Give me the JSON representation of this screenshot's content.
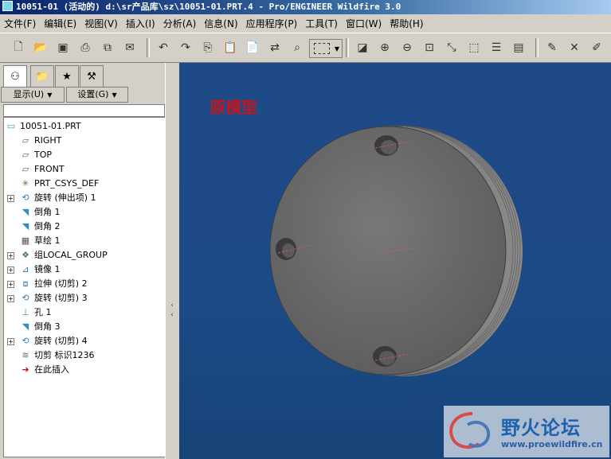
{
  "window": {
    "title": "10051-01 (活动的) d:\\sr产品库\\sz\\10051-01.PRT.4 - Pro/ENGINEER Wildfire 3.0"
  },
  "menu": [
    "文件(F)",
    "编辑(E)",
    "视图(V)",
    "插入(I)",
    "分析(A)",
    "信息(N)",
    "应用程序(P)",
    "工具(T)",
    "窗口(W)",
    "帮助(H)"
  ],
  "toolbar": {
    "icons": [
      "new-icon",
      "open-icon",
      "save-icon",
      "print-icon",
      "copy-window-icon",
      "email-icon",
      "undo-icon",
      "redo-icon",
      "copy-icon",
      "paste-icon",
      "paste-special-icon",
      "regenerate-icon",
      "find-icon",
      "select-box-icon",
      "repaint-icon",
      "zoom-in-icon",
      "zoom-out-icon",
      "refit-icon",
      "orient-icon",
      "saved-views-icon",
      "layers-icon",
      "view-manager-icon",
      "edit-definition-icon",
      "close-icon",
      "sketch-icon"
    ]
  },
  "panel": {
    "tabs": [
      "model-tree-tab",
      "folder-browser-tab",
      "favorites-tab",
      "connections-tab"
    ],
    "show_label": "显示(U)",
    "settings_label": "设置(G)"
  },
  "tree": [
    {
      "label": "10051-01.PRT",
      "icon": "part-icon",
      "indent": 0,
      "expandable": false
    },
    {
      "label": "RIGHT",
      "icon": "datum-plane-icon",
      "indent": 1,
      "expandable": false
    },
    {
      "label": "TOP",
      "icon": "datum-plane-icon",
      "indent": 1,
      "expandable": false
    },
    {
      "label": "FRONT",
      "icon": "datum-plane-icon",
      "indent": 1,
      "expandable": false
    },
    {
      "label": "PRT_CSYS_DEF",
      "icon": "csys-icon",
      "indent": 1,
      "expandable": false
    },
    {
      "label": "旋转 (伸出项) 1",
      "icon": "revolve-icon",
      "indent": 1,
      "expandable": true
    },
    {
      "label": "倒角 1",
      "icon": "chamfer-icon",
      "indent": 1,
      "expandable": false
    },
    {
      "label": "倒角 2",
      "icon": "chamfer-icon",
      "indent": 1,
      "expandable": false
    },
    {
      "label": "草绘 1",
      "icon": "sketch-icon",
      "indent": 1,
      "expandable": false
    },
    {
      "label": "组LOCAL_GROUP",
      "icon": "group-icon",
      "indent": 1,
      "expandable": true
    },
    {
      "label": "镜像 1",
      "icon": "mirror-icon",
      "indent": 1,
      "expandable": true
    },
    {
      "label": "拉伸 (切剪) 2",
      "icon": "extrude-icon",
      "indent": 1,
      "expandable": true
    },
    {
      "label": "旋转 (切剪) 3",
      "icon": "revolve-icon",
      "indent": 1,
      "expandable": true
    },
    {
      "label": "孔 1",
      "icon": "hole-icon",
      "indent": 1,
      "expandable": false
    },
    {
      "label": "倒角 3",
      "icon": "chamfer-icon",
      "indent": 1,
      "expandable": false
    },
    {
      "label": "旋转 (切剪) 4",
      "icon": "revolve-icon",
      "indent": 1,
      "expandable": true
    },
    {
      "label": "切剪 标识1236",
      "icon": "cut-icon",
      "indent": 1,
      "expandable": false
    },
    {
      "label": "在此插入",
      "icon": "insert-here-icon",
      "indent": 1,
      "expandable": false
    }
  ],
  "viewport": {
    "label": "原模型",
    "watermark_title": "野火论坛",
    "watermark_url": "www.proewildfire.cn"
  }
}
